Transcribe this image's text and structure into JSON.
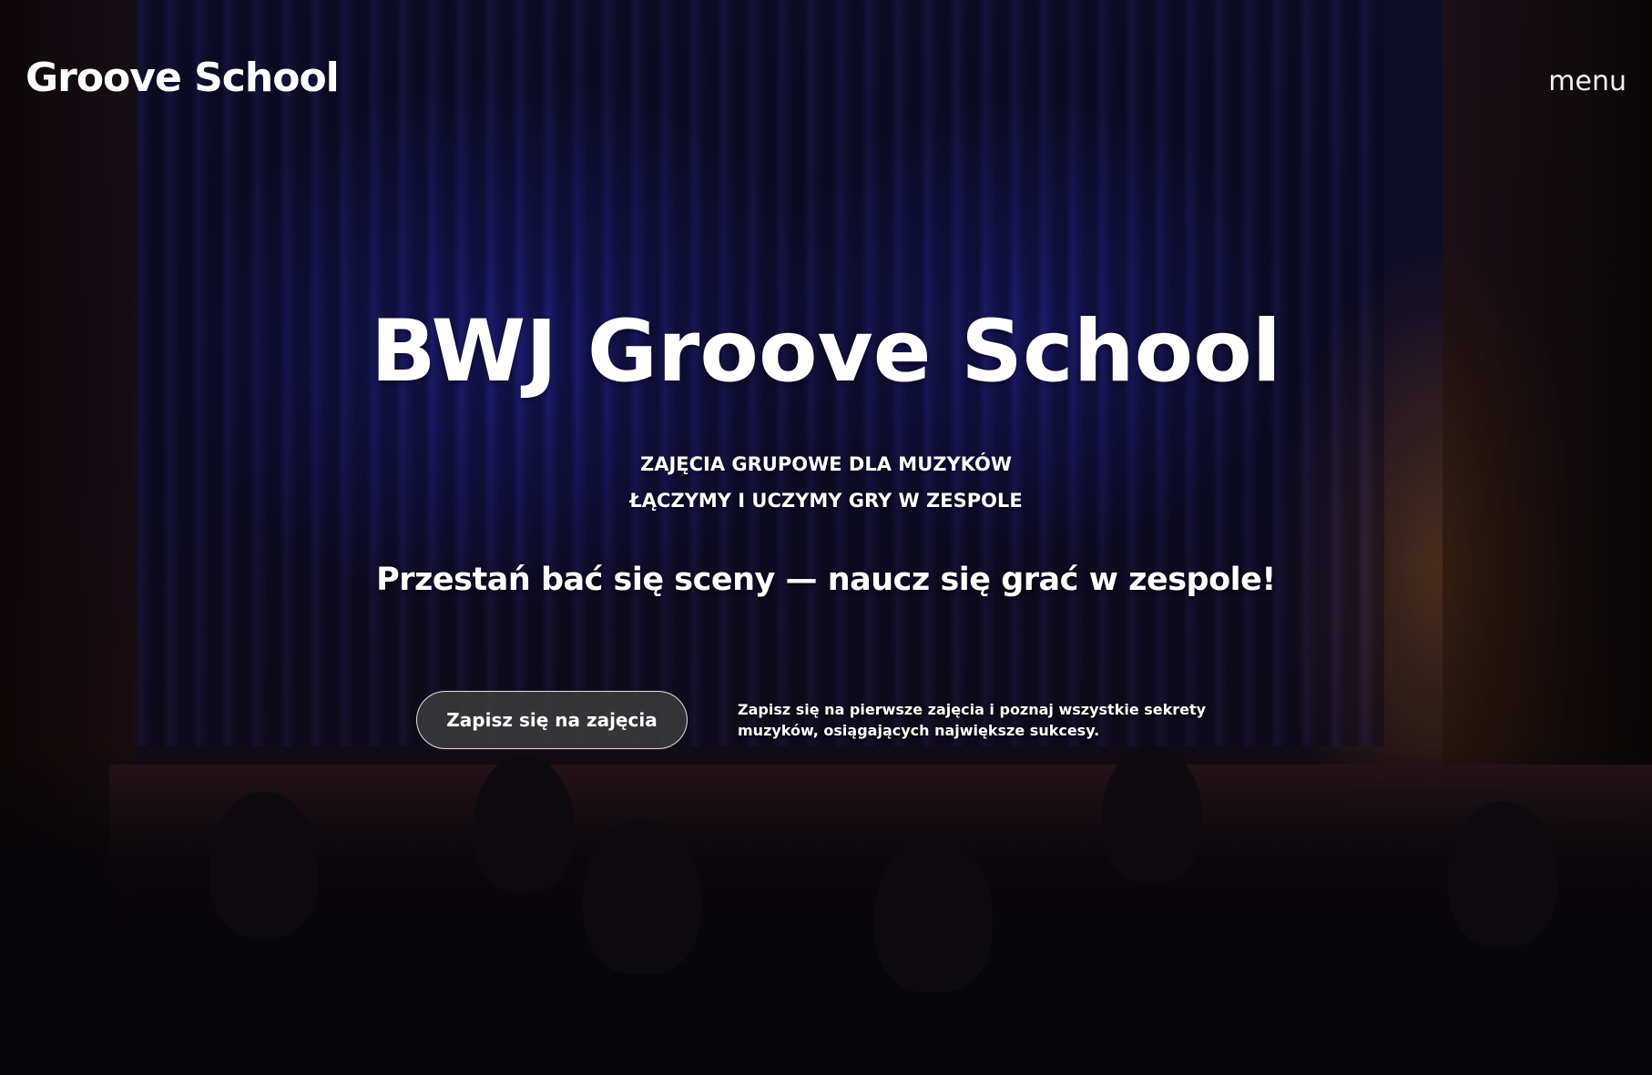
{
  "header": {
    "logo": "Groove School",
    "menu_label": "menu"
  },
  "hero": {
    "title": "BWJ Groove School",
    "subtitle_line1": "ZAJĘCIA GRUPOWE DLA MUZYKÓW",
    "subtitle_line2": "ŁĄCZYMY I UCZYMY GRY W ZESPOLE",
    "tagline": "Przestań bać się sceny — naucz się grać w zespole!",
    "cta_label": "Zapisz się na zajęcia",
    "cta_description": "Zapisz się na pierwsze zajęcia i poznaj wszystkie sekrety muzyków, osiągających największe sukcesy."
  },
  "colors": {
    "text": "#ffffff",
    "button_bg": "#3c3c3c",
    "curtain_blue": "#2828aa"
  }
}
